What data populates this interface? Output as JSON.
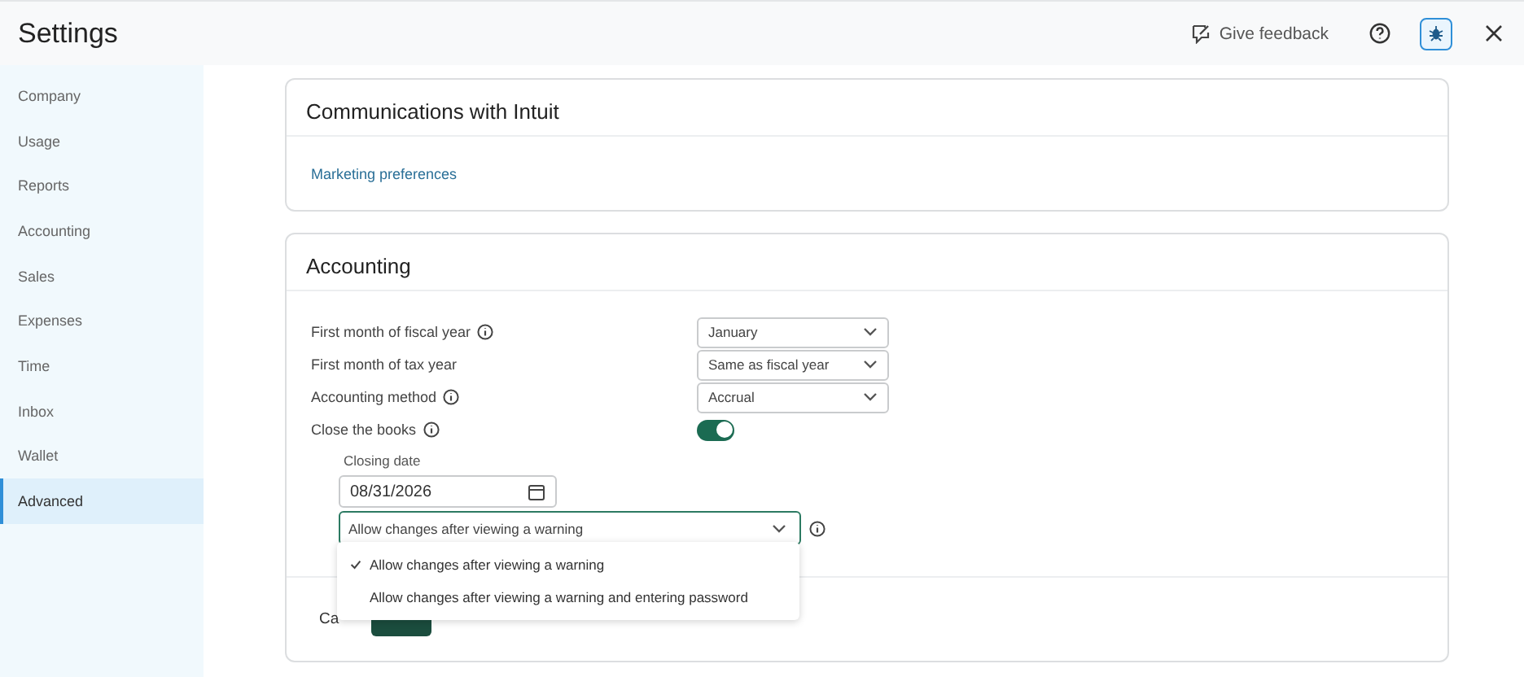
{
  "title": "Settings",
  "header_actions": {
    "feedback": "Give feedback"
  },
  "sidebar": {
    "items": [
      {
        "label": "Company",
        "selected": false
      },
      {
        "label": "Usage",
        "selected": false
      },
      {
        "label": "Reports",
        "selected": false
      },
      {
        "label": "Accounting",
        "selected": false
      },
      {
        "label": "Sales",
        "selected": false
      },
      {
        "label": "Expenses",
        "selected": false
      },
      {
        "label": "Time",
        "selected": false
      },
      {
        "label": "Inbox",
        "selected": false
      },
      {
        "label": "Wallet",
        "selected": false
      },
      {
        "label": "Advanced",
        "selected": true
      }
    ]
  },
  "communications": {
    "title": "Communications with Intuit",
    "link": "Marketing preferences"
  },
  "accounting": {
    "title": "Accounting",
    "rows": [
      {
        "label": "First month of fiscal year",
        "info": true,
        "kind": "select",
        "value": "January"
      },
      {
        "label": "First month of tax year",
        "info": false,
        "kind": "select",
        "value": "Same as fiscal year"
      },
      {
        "label": "Accounting method",
        "info": true,
        "kind": "select",
        "value": "Accrual"
      },
      {
        "label": "Close the books",
        "info": true,
        "kind": "toggle",
        "on": true
      }
    ],
    "closing_date_label": "Closing date",
    "closing_date": "08/31/2026",
    "closing_rule": "Allow changes after viewing a warning",
    "menu": [
      {
        "label": "Allow changes after viewing a warning",
        "selected": true
      },
      {
        "label": "Allow changes after viewing a warning and entering password",
        "selected": false
      }
    ],
    "cancel": "Ca"
  }
}
